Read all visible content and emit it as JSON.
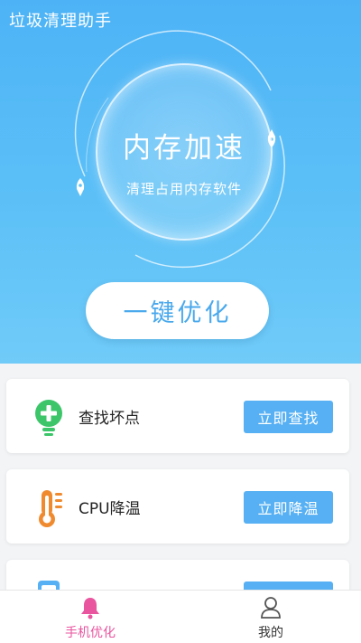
{
  "header": {
    "title": "垃圾清理助手"
  },
  "hero": {
    "circle_title": "内存加速",
    "circle_subtitle": "清理占用内存软件",
    "optimize_button": "一键优化"
  },
  "cards": [
    {
      "label": "查找坏点",
      "button": "立即查找",
      "icon": "bulb-plus-icon",
      "icon_color": "#3cc569"
    },
    {
      "label": "CPU降温",
      "button": "立即降温",
      "icon": "thermometer-icon",
      "icon_color": "#f08a2e"
    },
    {
      "label": "",
      "button": "",
      "icon": "phone-icon",
      "icon_color": "#56b0f3"
    }
  ],
  "tabbar": {
    "items": [
      {
        "label": "手机优化",
        "icon": "bell-icon",
        "active": true
      },
      {
        "label": "我的",
        "icon": "person-icon",
        "active": false
      }
    ],
    "active_color": "#e9559f",
    "inactive_color": "#333333"
  },
  "colors": {
    "accent": "#56b0f3",
    "hero_top": "#4db3f6",
    "hero_bottom": "#70cbf8"
  }
}
